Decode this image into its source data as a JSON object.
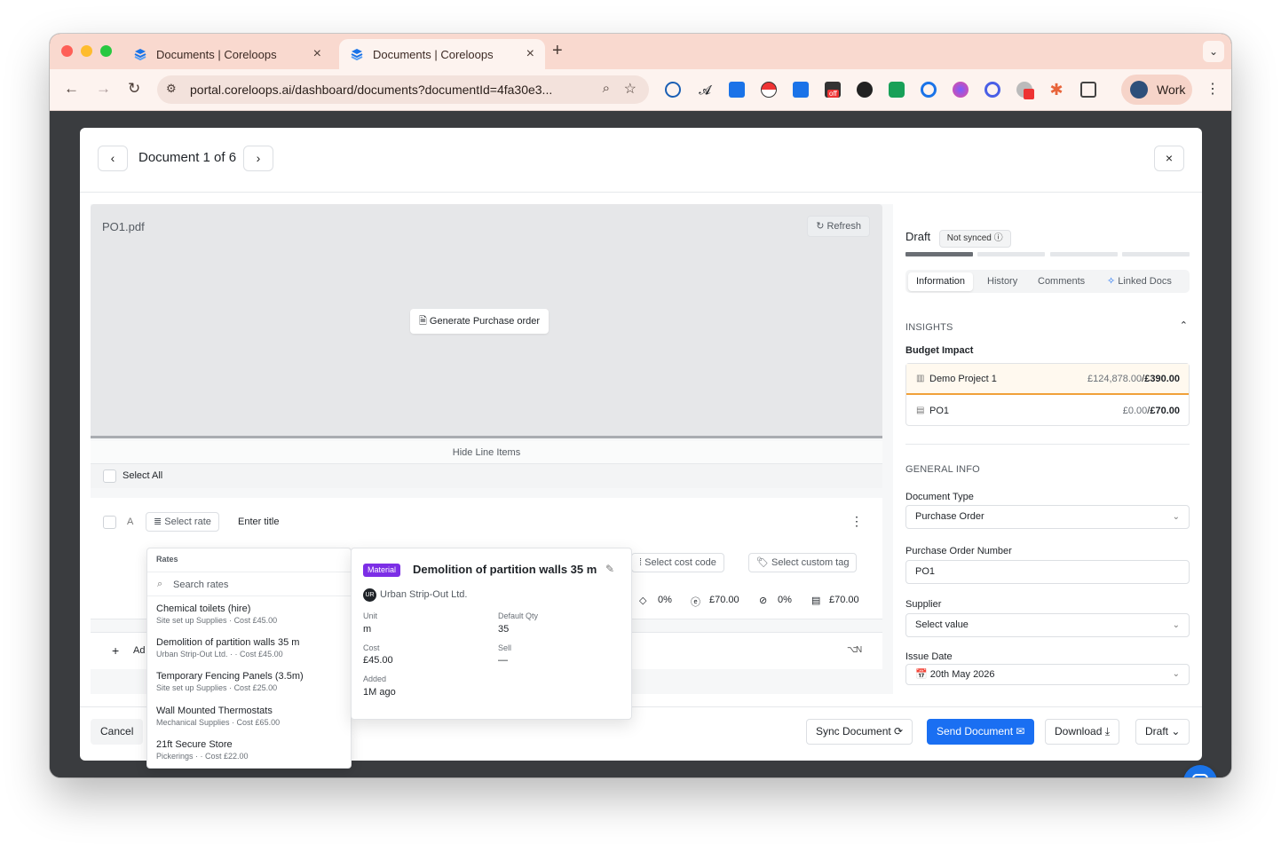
{
  "browser": {
    "tabs": [
      {
        "title": "Documents | Coreloops"
      },
      {
        "title": "Documents | Coreloops"
      }
    ],
    "url": "portal.coreloops.ai/dashboard/documents?documentId=4fa30e3...",
    "profile_label": "Work",
    "ext_badge": "off"
  },
  "modal": {
    "counter": "Document 1 of 6",
    "preview": {
      "file_name": "PO1.pdf",
      "refresh_label": "Refresh",
      "generate_label": "Generate Purchase order"
    },
    "line_items": {
      "hide_label": "Hide Line Items",
      "select_all_label": "Select All",
      "row": {
        "letter": "A",
        "select_rate_label": "Select rate",
        "title_placeholder": "Enter title",
        "cost_code_label": "Select cost code",
        "custom_tag_label": "Select custom tag",
        "discount": "0%",
        "price": "£70.00",
        "tax": "0%",
        "total": "£70.00"
      },
      "add_label": "Ad",
      "shortcut": "N"
    },
    "rates_dropdown": {
      "header": "Rates",
      "search_placeholder": "Search rates",
      "items": [
        {
          "name": "Chemical toilets (hire)",
          "group": "Site set up Supplies",
          "cost": "Cost £45.00"
        },
        {
          "name": "Demolition of partition walls 35 m",
          "group": "Urban Strip-Out Ltd.",
          "cost": "Cost £45.00"
        },
        {
          "name": "Temporary Fencing Panels (3.5m)",
          "group": "Site set up Supplies",
          "cost": "Cost £25.00"
        },
        {
          "name": "Wall Mounted Thermostats",
          "group": "Mechanical Supplies",
          "cost": "Cost £65.00"
        },
        {
          "name": "21ft Secure Store",
          "group": "Pickerings",
          "cost": "Cost £22.00"
        }
      ]
    },
    "rate_detail": {
      "pill": "Material",
      "title": "Demolition of partition walls 35 m",
      "supplier_initials": "UR",
      "supplier": "Urban Strip-Out Ltd.",
      "unit_label": "Unit",
      "unit_value": "m",
      "default_qty_label": "Default Qty",
      "default_qty_value": "35",
      "cost_label": "Cost",
      "cost_value": "£45.00",
      "sell_label": "Sell",
      "sell_value": "—",
      "added_label": "Added",
      "added_value": "1M ago"
    },
    "panel": {
      "status": "Draft",
      "sync_badge": "Not synced",
      "progress_steps": 4,
      "progress_done": 1,
      "tabs": [
        "Information",
        "History",
        "Comments",
        "Linked Docs"
      ],
      "active_tab": "Information",
      "insights_title": "INSIGHTS",
      "budget_title": "Budget Impact",
      "budget_rows": [
        {
          "name": "Demo Project 1",
          "base": "£124,878.00",
          "sep": "/",
          "delta": "£390.00"
        },
        {
          "name": "PO1",
          "base": "£0.00",
          "sep": "/",
          "delta": "£70.00"
        }
      ],
      "general_title": "GENERAL INFO",
      "document_type_label": "Document Type",
      "document_type_value": "Purchase Order",
      "po_number_label": "Purchase Order Number",
      "po_number_value": "PO1",
      "supplier_label": "Supplier",
      "supplier_value": "Select value",
      "issue_date_label": "Issue Date",
      "issue_date_value": "20th May 2026"
    },
    "footer": {
      "cancel": "Cancel",
      "sync": "Sync Document",
      "send": "Send Document",
      "download": "Download",
      "draft": "Draft"
    }
  },
  "colors": {
    "accent": "#1a6ff2",
    "material_pill": "#7c2ee6",
    "budget_highlight": "#f0a13a",
    "tabstrip": "#f9d9cf"
  }
}
